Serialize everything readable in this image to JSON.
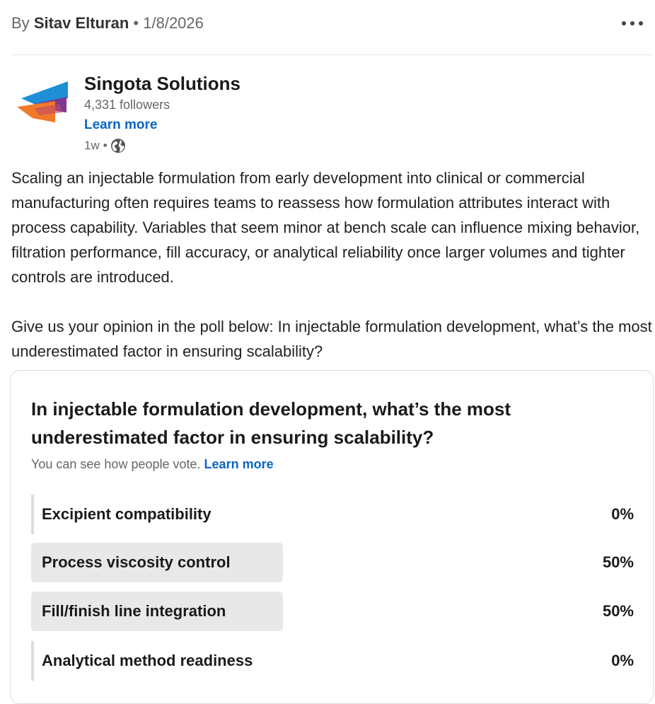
{
  "byline": {
    "prefix": "By",
    "author": "Sitav Elturan",
    "separator": "•",
    "date": "1/8/2026"
  },
  "company": {
    "name": "Singota Solutions",
    "followers": "4,331 followers",
    "learn_more": "Learn more",
    "age": "1w",
    "separator": "•",
    "visibility_icon": "globe-icon",
    "logo_colors": [
      "#1e8fd5",
      "#7d3a8c",
      "#f07a2a"
    ]
  },
  "post": {
    "paragraphs": [
      "Scaling an injectable formulation from early development into clinical or commercial manufacturing often requires teams to reassess how formulation attributes interact with process capability. Variables that seem minor at bench scale can influence mixing behavior, filtration performance, fill accuracy, or analytical reliability once larger volumes and tighter controls are introduced.",
      "Give us your opinion in the poll below: In injectable formulation development, what’s the most underestimated factor in ensuring scalability?"
    ]
  },
  "poll": {
    "question": "In injectable formulation development, what’s the most underestimated factor in ensuring scalability?",
    "subtext": "You can see how people vote.",
    "learn_more": "Learn more",
    "options": [
      {
        "label": "Excipient compatibility",
        "percent": "0%",
        "fraction": 0
      },
      {
        "label": "Process viscosity control",
        "percent": "50%",
        "fraction": 0.5
      },
      {
        "label": "Fill/finish line integration",
        "percent": "50%",
        "fraction": 0.5
      },
      {
        "label": "Analytical method readiness",
        "percent": "0%",
        "fraction": 0
      }
    ]
  },
  "colors": {
    "link": "#0a66c2",
    "bar": "#e8e8e8",
    "border": "#dcdcdc"
  }
}
